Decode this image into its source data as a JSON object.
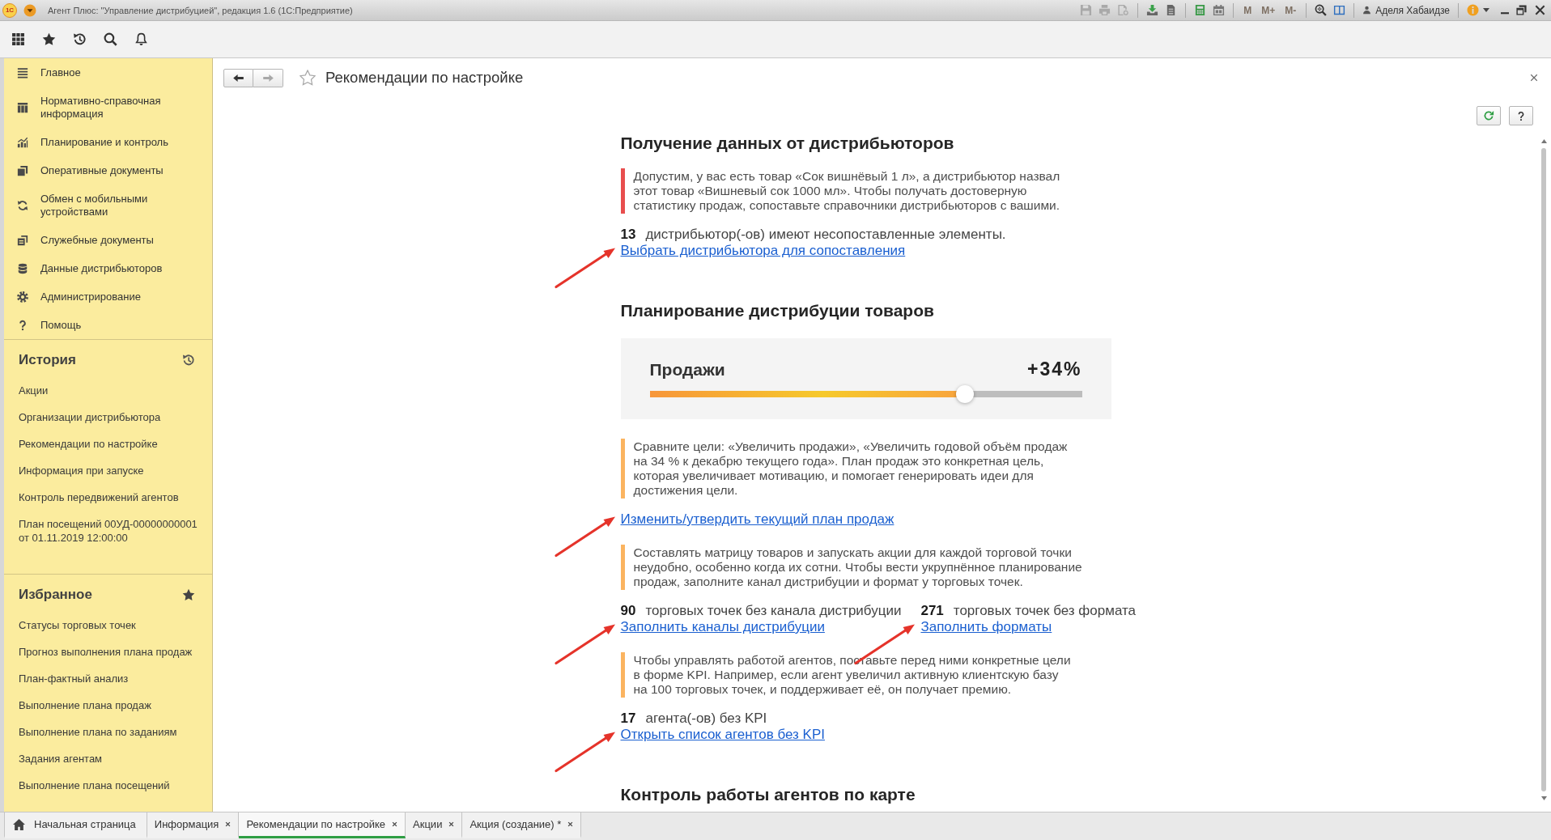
{
  "window": {
    "logo": "1С",
    "title": "Агент Плюс: \"Управление дистрибуцией\", редакция 1.6 (1С:Предприятие)",
    "memory_buttons": [
      {
        "label": "M",
        "disabled": true
      },
      {
        "label": "M+",
        "disabled": true
      },
      {
        "label": "M-",
        "disabled": true
      }
    ],
    "user": "Аделя Хабаидзе"
  },
  "sidebar": {
    "sections": [
      "Главное",
      "Нормативно-справочная информация",
      "Планирование и контроль",
      "Оперативные документы",
      "Обмен с мобильными устройствами",
      "Служебные документы",
      "Данные дистрибьюторов",
      "Администрирование",
      "Помощь"
    ],
    "history": {
      "title": "История",
      "items": [
        "Акции",
        "Организации дистрибьютора",
        "Рекомендации по настройке",
        "Информация при запуске",
        "Контроль передвижений агентов",
        "План посещений 00УД-00000000001 от 01.11.2019 12:00:00"
      ]
    },
    "favorites": {
      "title": "Избранное",
      "items": [
        "Статусы торговых точек",
        "Прогноз выполнения плана продаж",
        "План-фактный анализ",
        "Выполнение плана продаж",
        "Выполнение плана по заданиям",
        "Задания агентам",
        "Выполнение плана посещений"
      ]
    }
  },
  "page": {
    "title": "Рекомендации по настройке",
    "navigation": {
      "back_disabled": false,
      "forward_disabled": true
    },
    "blocks": [
      {
        "kind": "heading",
        "text": "Получение данных от дистрибьюторов"
      },
      {
        "kind": "note",
        "color": "#e84e4e",
        "text": "Допустим, у вас есть товар «Сок вишнёвый 1 л», а дистрибьютор назвал этот товар «Вишневый сок 1000 мл». Чтобы получать достоверную статистику продаж, сопоставьте справочники дистрибьюторов с вашими."
      },
      {
        "kind": "stats",
        "items": [
          {
            "count": "13",
            "text": "дистрибьютор(-ов) имеют несопоставленные элементы.",
            "link": "Выбрать дистрибьютора для сопоставления"
          }
        ]
      },
      {
        "kind": "heading",
        "text": "Планирование дистрибуции товаров"
      },
      {
        "kind": "slider",
        "label": "Продажи",
        "reading": "+34%",
        "level": 0.73
      },
      {
        "kind": "note",
        "color": "#fbb460",
        "text": "Сравните цели: «Увеличить продажи», «Увеличить годовой объём продаж на 34 % к декабрю текущего года». План продаж это конкретная цель, которая увеличивает мотивацию, и помогает генерировать идеи для достижения цели."
      },
      {
        "kind": "link",
        "text": "Изменить/утвердить текущий план продаж"
      },
      {
        "kind": "note",
        "color": "#fbb460",
        "text": "Составлять матрицу товаров и запускать акции для каждой торговой точки неудобно, особенно когда их сотни. Чтобы вести укрупнённое планирование продаж, заполните канал дистрибуции и формат у торговых точек."
      },
      {
        "kind": "stats",
        "items": [
          {
            "count": "90",
            "text": "торговых точек без канала дистрибуции",
            "link": "Заполнить каналы дистрибуции"
          },
          {
            "count": "271",
            "text": "торговых точек без формата",
            "link": "Заполнить форматы"
          }
        ]
      },
      {
        "kind": "note",
        "color": "#fbb460",
        "text": "Чтобы управлять работой агентов, поставьте перед ними конкретные цели в форме KPI. Например, если агент увеличил активную клиентскую базу на 100 торговых точек, и поддерживает её, он получает премию."
      },
      {
        "kind": "stats",
        "items": [
          {
            "count": "17",
            "text": "агента(-ов) без KPI",
            "link": "Открыть список агентов без KPI"
          }
        ]
      },
      {
        "kind": "heading",
        "text": "Контроль работы агентов по карте"
      }
    ]
  },
  "open_tabs": [
    {
      "kind": "home",
      "label": "Начальная страница",
      "selected": false
    },
    {
      "kind": "page",
      "label": "Информация",
      "selected": false
    },
    {
      "kind": "page",
      "label": "Рекомендации по настройке",
      "selected": true
    },
    {
      "kind": "page",
      "label": "Акции",
      "selected": false
    },
    {
      "kind": "page",
      "label": "Акция (создание) *",
      "selected": false
    }
  ]
}
